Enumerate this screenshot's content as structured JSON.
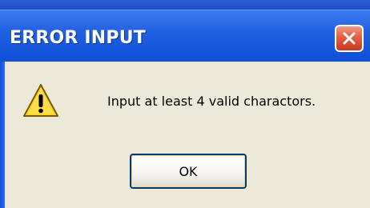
{
  "dialog": {
    "title": "ERROR INPUT",
    "message": "Input at least 4 valid charactors.",
    "ok_label": "OK"
  },
  "icons": {
    "close": "close-icon",
    "warning": "warning-icon"
  },
  "colors": {
    "titlebar": "#1f5fe0",
    "close_button": "#e15e41",
    "client_background": "#ece9d8",
    "button_border": "#003c74"
  }
}
